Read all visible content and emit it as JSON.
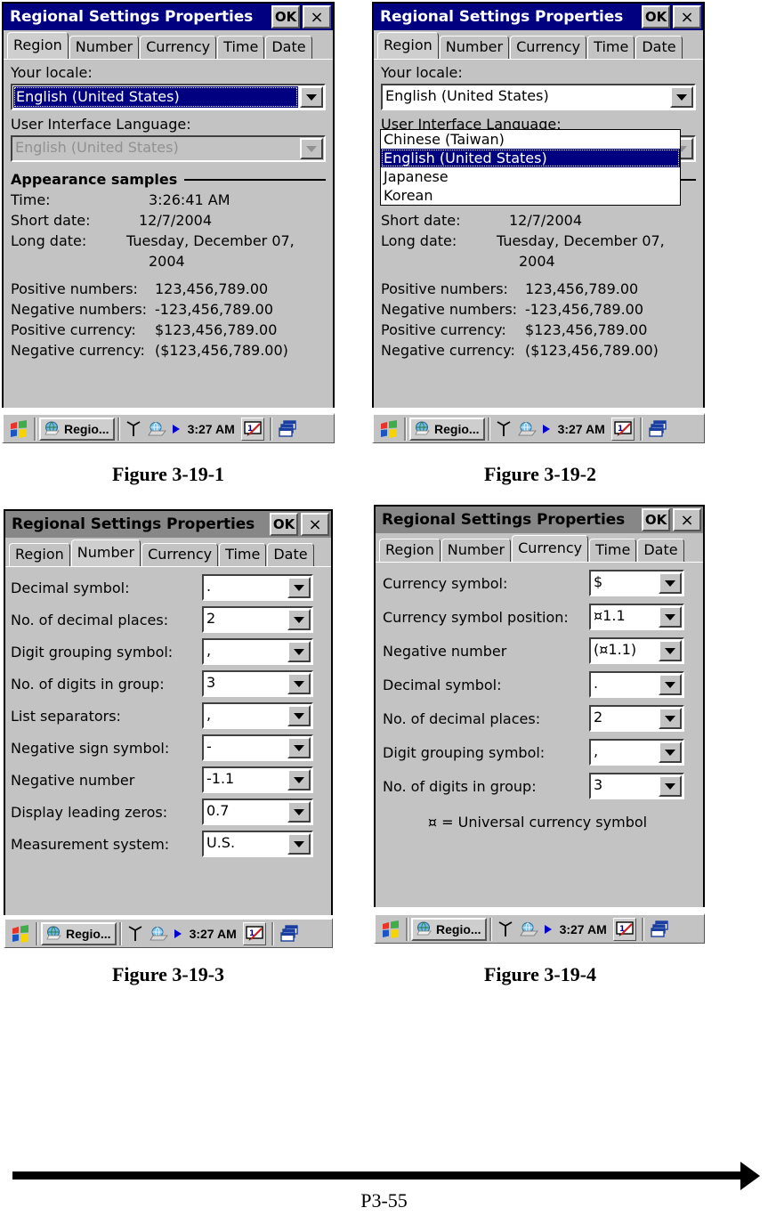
{
  "window": {
    "title": "Regional Settings Properties",
    "ok_label": "OK",
    "close_label": "×",
    "tabs": [
      "Region",
      "Number",
      "Currency",
      "Time",
      "Date"
    ]
  },
  "colors": {
    "titlebar_active": "#000080",
    "titlebar_inactive": "#878787",
    "selection": "#000080",
    "face": "#c3c3c3"
  },
  "region_tab": {
    "locale_label": "Your locale:",
    "locale_value": "English (United States)",
    "uilang_label": "User Interface Language:",
    "uilang_value": "English (United States)",
    "group_title": "Appearance samples",
    "samples": [
      {
        "key": "Time:",
        "value": "3:26:41 AM"
      },
      {
        "key": "Short date:",
        "value": "12/7/2004"
      },
      {
        "key": "Long date:",
        "value": "Tuesday, December 07,"
      }
    ],
    "long_date_cont": "2004",
    "numbers": [
      {
        "key": "Positive numbers:",
        "value": "123,456,789.00"
      },
      {
        "key": "Negative numbers:",
        "value": "-123,456,789.00"
      },
      {
        "key": "Positive currency:",
        "value": "$123,456,789.00"
      },
      {
        "key": "Negative currency:",
        "value": "($123,456,789.00)"
      }
    ],
    "dropdown_options": [
      "Chinese (Taiwan)",
      "English (United States)",
      "Japanese",
      "Korean"
    ],
    "dropdown_selected_index": 1
  },
  "number_tab": {
    "rows": [
      {
        "label": "Decimal symbol:",
        "value": "."
      },
      {
        "label": "No. of decimal places:",
        "value": "2"
      },
      {
        "label": "Digit grouping symbol:",
        "value": ","
      },
      {
        "label": "No. of digits in group:",
        "value": "3"
      },
      {
        "label": "List separators:",
        "value": ","
      },
      {
        "label": "Negative sign symbol:",
        "value": "-"
      },
      {
        "label": "Negative number",
        "value": "-1.1"
      },
      {
        "label": "Display leading zeros:",
        "value": "0.7"
      },
      {
        "label": "Measurement system:",
        "value": "U.S."
      }
    ]
  },
  "currency_tab": {
    "rows": [
      {
        "label": "Currency symbol:",
        "value": "$"
      },
      {
        "label": "Currency symbol position:",
        "value": "¤1.1"
      },
      {
        "label": "Negative number",
        "value": "(¤1.1)"
      },
      {
        "label": "Decimal symbol:",
        "value": "."
      },
      {
        "label": "No. of decimal places:",
        "value": "2"
      },
      {
        "label": "Digit grouping symbol:",
        "value": ","
      },
      {
        "label": "No. of digits in group:",
        "value": "3"
      }
    ],
    "note": "¤ = Universal currency symbol"
  },
  "taskbar": {
    "task_label": "Regio...",
    "clock": "3:27 AM",
    "start_icon": "windows-flag-icon",
    "task_icon": "globe-icon",
    "tray_icons": [
      "antenna-icon",
      "network-globe-icon",
      "play-arrow-icon"
    ],
    "sip_icon": "input-panel-pen-icon",
    "desktop_icon": "cascading-windows-icon"
  },
  "captions": {
    "fig1": "Figure 3-19-1",
    "fig2": "Figure 3-19-2",
    "fig3": "Figure 3-19-3",
    "fig4": "Figure 3-19-4"
  },
  "footer": {
    "page": "P3-55"
  }
}
